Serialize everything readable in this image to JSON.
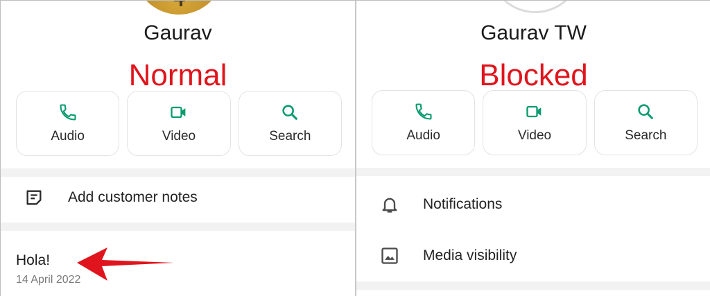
{
  "left": {
    "contact_name": "Gaurav",
    "annotation": "Normal",
    "actions": [
      {
        "label": "Audio",
        "icon": "phone-icon"
      },
      {
        "label": "Video",
        "icon": "video-icon"
      },
      {
        "label": "Search",
        "icon": "search-icon"
      }
    ],
    "notes_row": {
      "label": "Add customer notes",
      "icon": "notes-icon"
    },
    "about": {
      "text": "Hola!",
      "date": "14 April 2022"
    }
  },
  "right": {
    "contact_name": "Gaurav TW",
    "annotation": "Blocked",
    "actions": [
      {
        "label": "Audio",
        "icon": "phone-icon"
      },
      {
        "label": "Video",
        "icon": "video-icon"
      },
      {
        "label": "Search",
        "icon": "search-icon"
      }
    ],
    "rows": [
      {
        "label": "Notifications",
        "icon": "bell-icon"
      },
      {
        "label": "Media visibility",
        "icon": "image-icon"
      }
    ]
  },
  "colors": {
    "accent": "#0a9b6f",
    "annotation": "#e0141c",
    "arrow": "#e0141c"
  }
}
